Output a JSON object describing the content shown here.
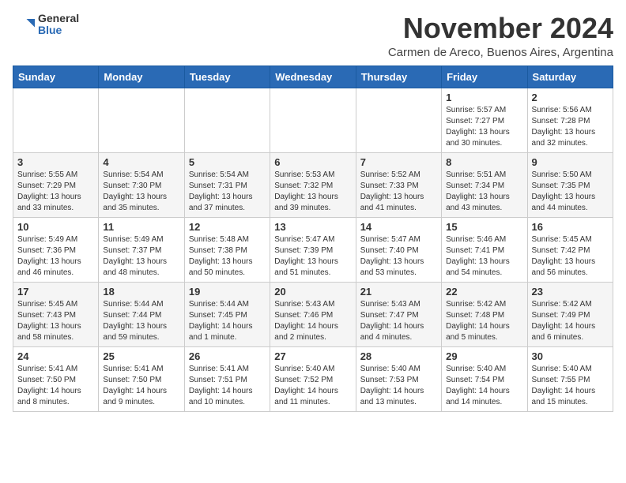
{
  "logo": {
    "general": "General",
    "blue": "Blue"
  },
  "title": "November 2024",
  "location": "Carmen de Areco, Buenos Aires, Argentina",
  "weekdays": [
    "Sunday",
    "Monday",
    "Tuesday",
    "Wednesday",
    "Thursday",
    "Friday",
    "Saturday"
  ],
  "weeks": [
    [
      {
        "day": "",
        "info": ""
      },
      {
        "day": "",
        "info": ""
      },
      {
        "day": "",
        "info": ""
      },
      {
        "day": "",
        "info": ""
      },
      {
        "day": "",
        "info": ""
      },
      {
        "day": "1",
        "info": "Sunrise: 5:57 AM\nSunset: 7:27 PM\nDaylight: 13 hours\nand 30 minutes."
      },
      {
        "day": "2",
        "info": "Sunrise: 5:56 AM\nSunset: 7:28 PM\nDaylight: 13 hours\nand 32 minutes."
      }
    ],
    [
      {
        "day": "3",
        "info": "Sunrise: 5:55 AM\nSunset: 7:29 PM\nDaylight: 13 hours\nand 33 minutes."
      },
      {
        "day": "4",
        "info": "Sunrise: 5:54 AM\nSunset: 7:30 PM\nDaylight: 13 hours\nand 35 minutes."
      },
      {
        "day": "5",
        "info": "Sunrise: 5:54 AM\nSunset: 7:31 PM\nDaylight: 13 hours\nand 37 minutes."
      },
      {
        "day": "6",
        "info": "Sunrise: 5:53 AM\nSunset: 7:32 PM\nDaylight: 13 hours\nand 39 minutes."
      },
      {
        "day": "7",
        "info": "Sunrise: 5:52 AM\nSunset: 7:33 PM\nDaylight: 13 hours\nand 41 minutes."
      },
      {
        "day": "8",
        "info": "Sunrise: 5:51 AM\nSunset: 7:34 PM\nDaylight: 13 hours\nand 43 minutes."
      },
      {
        "day": "9",
        "info": "Sunrise: 5:50 AM\nSunset: 7:35 PM\nDaylight: 13 hours\nand 44 minutes."
      }
    ],
    [
      {
        "day": "10",
        "info": "Sunrise: 5:49 AM\nSunset: 7:36 PM\nDaylight: 13 hours\nand 46 minutes."
      },
      {
        "day": "11",
        "info": "Sunrise: 5:49 AM\nSunset: 7:37 PM\nDaylight: 13 hours\nand 48 minutes."
      },
      {
        "day": "12",
        "info": "Sunrise: 5:48 AM\nSunset: 7:38 PM\nDaylight: 13 hours\nand 50 minutes."
      },
      {
        "day": "13",
        "info": "Sunrise: 5:47 AM\nSunset: 7:39 PM\nDaylight: 13 hours\nand 51 minutes."
      },
      {
        "day": "14",
        "info": "Sunrise: 5:47 AM\nSunset: 7:40 PM\nDaylight: 13 hours\nand 53 minutes."
      },
      {
        "day": "15",
        "info": "Sunrise: 5:46 AM\nSunset: 7:41 PM\nDaylight: 13 hours\nand 54 minutes."
      },
      {
        "day": "16",
        "info": "Sunrise: 5:45 AM\nSunset: 7:42 PM\nDaylight: 13 hours\nand 56 minutes."
      }
    ],
    [
      {
        "day": "17",
        "info": "Sunrise: 5:45 AM\nSunset: 7:43 PM\nDaylight: 13 hours\nand 58 minutes."
      },
      {
        "day": "18",
        "info": "Sunrise: 5:44 AM\nSunset: 7:44 PM\nDaylight: 13 hours\nand 59 minutes."
      },
      {
        "day": "19",
        "info": "Sunrise: 5:44 AM\nSunset: 7:45 PM\nDaylight: 14 hours\nand 1 minute."
      },
      {
        "day": "20",
        "info": "Sunrise: 5:43 AM\nSunset: 7:46 PM\nDaylight: 14 hours\nand 2 minutes."
      },
      {
        "day": "21",
        "info": "Sunrise: 5:43 AM\nSunset: 7:47 PM\nDaylight: 14 hours\nand 4 minutes."
      },
      {
        "day": "22",
        "info": "Sunrise: 5:42 AM\nSunset: 7:48 PM\nDaylight: 14 hours\nand 5 minutes."
      },
      {
        "day": "23",
        "info": "Sunrise: 5:42 AM\nSunset: 7:49 PM\nDaylight: 14 hours\nand 6 minutes."
      }
    ],
    [
      {
        "day": "24",
        "info": "Sunrise: 5:41 AM\nSunset: 7:50 PM\nDaylight: 14 hours\nand 8 minutes."
      },
      {
        "day": "25",
        "info": "Sunrise: 5:41 AM\nSunset: 7:50 PM\nDaylight: 14 hours\nand 9 minutes."
      },
      {
        "day": "26",
        "info": "Sunrise: 5:41 AM\nSunset: 7:51 PM\nDaylight: 14 hours\nand 10 minutes."
      },
      {
        "day": "27",
        "info": "Sunrise: 5:40 AM\nSunset: 7:52 PM\nDaylight: 14 hours\nand 11 minutes."
      },
      {
        "day": "28",
        "info": "Sunrise: 5:40 AM\nSunset: 7:53 PM\nDaylight: 14 hours\nand 13 minutes."
      },
      {
        "day": "29",
        "info": "Sunrise: 5:40 AM\nSunset: 7:54 PM\nDaylight: 14 hours\nand 14 minutes."
      },
      {
        "day": "30",
        "info": "Sunrise: 5:40 AM\nSunset: 7:55 PM\nDaylight: 14 hours\nand 15 minutes."
      }
    ]
  ]
}
